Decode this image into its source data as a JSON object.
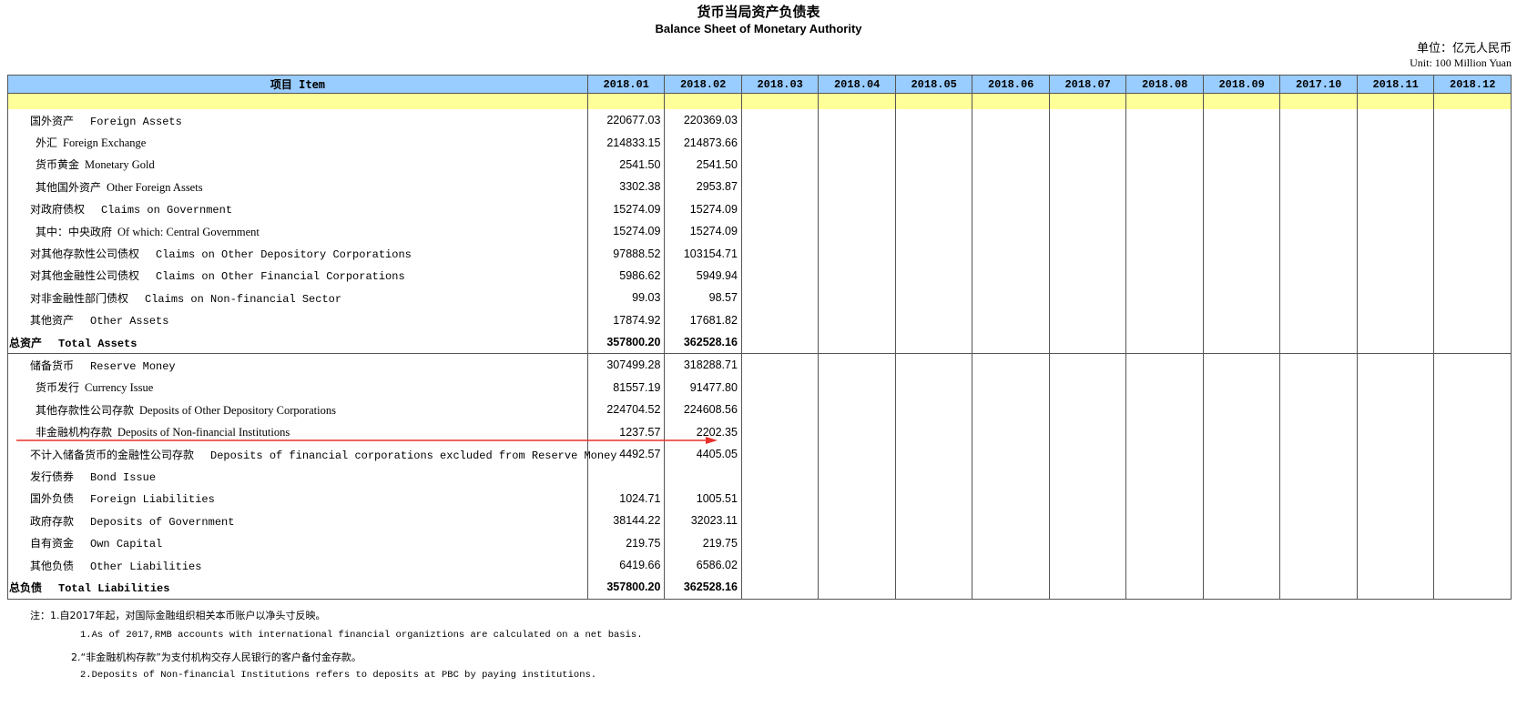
{
  "title": {
    "cn": "货币当局资产负债表",
    "en": "Balance Sheet of  Monetary Authority"
  },
  "unit": {
    "cn": "单位：亿元人民币",
    "en": "Unit: 100 Million Yuan"
  },
  "columns": {
    "item": "项目    Item",
    "months": [
      "2018.01",
      "2018.02",
      "2018.03",
      "2018.04",
      "2018.05",
      "2018.06",
      "2018.07",
      "2018.08",
      "2018.09",
      "2017.10",
      "2018.11",
      "2018.12"
    ]
  },
  "rows": [
    {
      "cn": "国外资产",
      "en": "Foreign Assets",
      "indent": 1,
      "v1": "220677.03",
      "v2": "220369.03"
    },
    {
      "cn": "外汇",
      "en": "Foreign Exchange",
      "indent": 2,
      "sub": true,
      "v1": "214833.15",
      "v2": "214873.66"
    },
    {
      "cn": "货币黄金",
      "en": "Monetary Gold",
      "indent": 2,
      "sub": true,
      "v1": "2541.50",
      "v2": "2541.50"
    },
    {
      "cn": "其他国外资产",
      "en": "Other Foreign Assets",
      "indent": 2,
      "sub": true,
      "v1": "3302.38",
      "v2": "2953.87"
    },
    {
      "cn": "对政府债权",
      "en": "Claims on Government",
      "indent": 1,
      "v1": "15274.09",
      "v2": "15274.09"
    },
    {
      "cn": "其中：中央政府",
      "en": "Of which: Central Government",
      "indent": 2,
      "sub": true,
      "v1": "15274.09",
      "v2": "15274.09"
    },
    {
      "cn": "对其他存款性公司债权",
      "en": "Claims on Other Depository Corporations",
      "indent": 1,
      "v1": "97888.52",
      "v2": "103154.71"
    },
    {
      "cn": "对其他金融性公司债权",
      "en": "Claims on Other Financial Corporations",
      "indent": 1,
      "v1": "5986.62",
      "v2": "5949.94"
    },
    {
      "cn": "对非金融性部门债权",
      "en": "Claims on Non-financial Sector",
      "indent": 1,
      "v1": "99.03",
      "v2": "98.57"
    },
    {
      "cn": "其他资产",
      "en": "Other Assets",
      "indent": 1,
      "v1": "17874.92",
      "v2": "17681.82"
    },
    {
      "cn": "总资产",
      "en": "Total Assets",
      "indent": 0,
      "total": true,
      "v1": "357800.20",
      "v2": "362528.16"
    },
    {
      "cn": "储备货币",
      "en": "Reserve Money",
      "indent": 1,
      "v1": "307499.28",
      "v2": "318288.71"
    },
    {
      "cn": "货币发行",
      "en": "Currency Issue",
      "indent": 2,
      "sub": true,
      "v1": "81557.19",
      "v2": "91477.80"
    },
    {
      "cn": "其他存款性公司存款",
      "en": "Deposits of Other Depository Corporations",
      "indent": 2,
      "sub": true,
      "v1": "224704.52",
      "v2": "224608.56"
    },
    {
      "cn": "非金融机构存款",
      "en": "Deposits of Non-financial Institutions",
      "indent": 2,
      "sub": true,
      "v1": "1237.57",
      "v2": "2202.35"
    },
    {
      "cn": "不计入储备货币的金融性公司存款",
      "en": "Deposits of financial corporations excluded from Reserve Money",
      "indent": 1,
      "v1": "4492.57",
      "v2": "4405.05"
    },
    {
      "cn": "发行债券",
      "en": "Bond Issue",
      "indent": 1,
      "v1": "",
      "v2": ""
    },
    {
      "cn": "国外负债",
      "en": "Foreign Liabilities",
      "indent": 1,
      "v1": "1024.71",
      "v2": "1005.51"
    },
    {
      "cn": "政府存款",
      "en": "Deposits of Government",
      "indent": 1,
      "v1": "38144.22",
      "v2": "32023.11"
    },
    {
      "cn": "自有资金",
      "en": "Own Capital",
      "indent": 1,
      "v1": "219.75",
      "v2": "219.75"
    },
    {
      "cn": "其他负债",
      "en": "Other Liabilities",
      "indent": 1,
      "v1": "6419.66",
      "v2": "6586.02"
    },
    {
      "cn": "总负债",
      "en": "Total   Liabilities",
      "indent": 0,
      "total": true,
      "v1": "357800.20",
      "v2": "362528.16"
    }
  ],
  "notes": [
    {
      "lang": "cn",
      "text": "注：1.自2017年起，对国际金融组织相关本币账户以净头寸反映。"
    },
    {
      "lang": "en",
      "text": "1.As of 2017,RMB accounts with international financial organiztions are calculated on a net basis."
    },
    {
      "lang": "cn",
      "text": "2.“非金融机构存款”为支付机构交存人民银行的客户备付金存款。"
    },
    {
      "lang": "en",
      "text": "2.Deposits of Non-financial Institutions refers to deposits at PBC by paying institutions."
    }
  ],
  "colors": {
    "header_bg": "#99ccff",
    "band_bg": "#ffff99",
    "arrow": "#e8302a"
  }
}
